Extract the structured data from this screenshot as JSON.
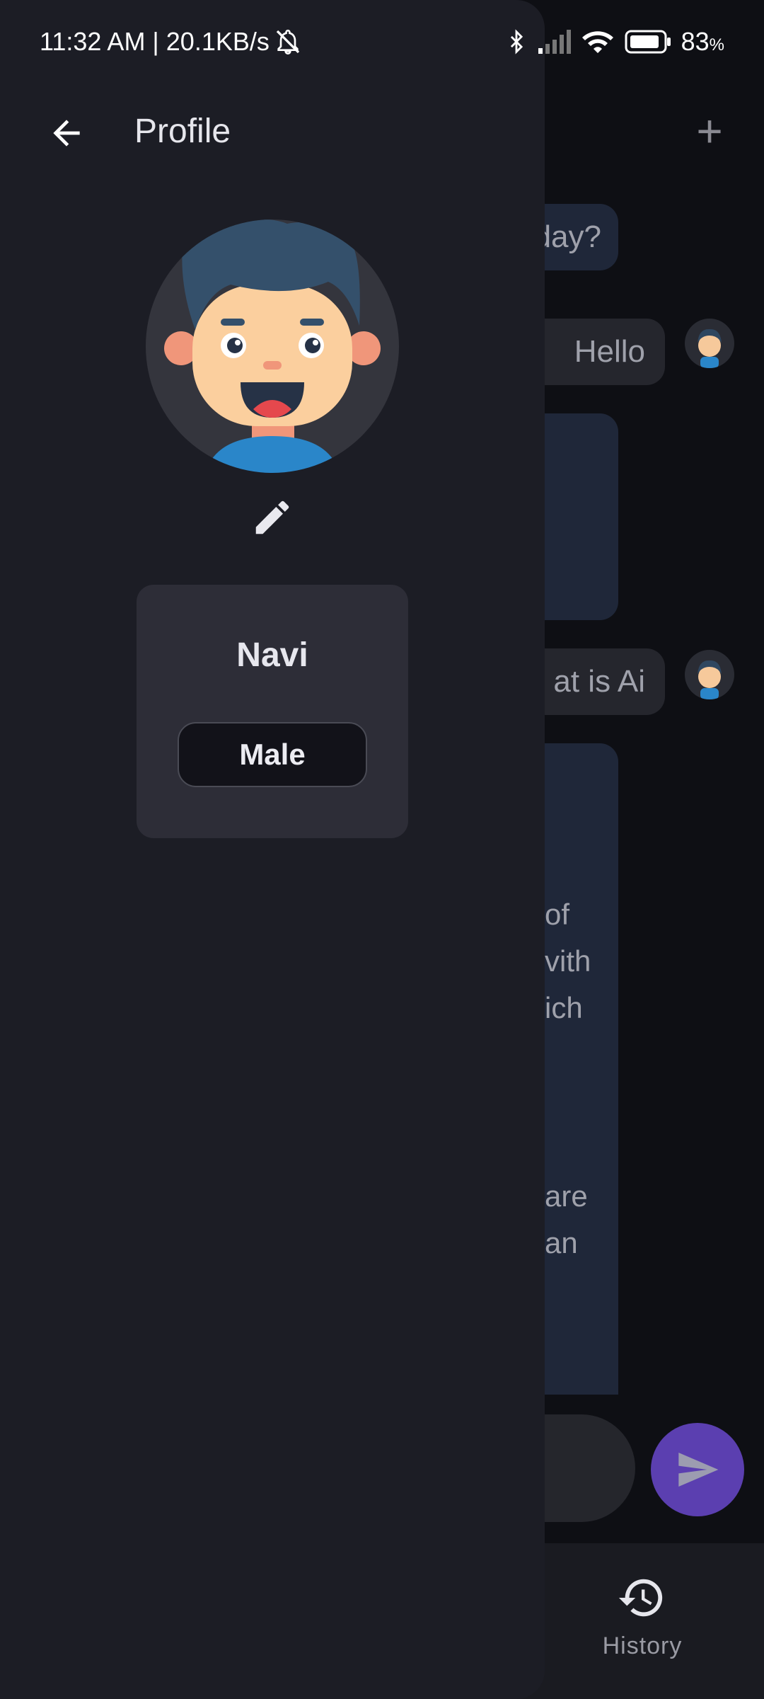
{
  "status_bar": {
    "time": "11:32 AM | 20.1KB/s",
    "battery": "83",
    "battery_unit": "%",
    "icons": [
      "mute-icon",
      "bluetooth-icon",
      "signal-icon",
      "wifi-icon",
      "battery-icon"
    ]
  },
  "drawer": {
    "title": "Profile",
    "back_icon": "arrow-left-icon",
    "edit_icon": "pencil-icon",
    "profile": {
      "name": "Navi",
      "gender": "Male"
    }
  },
  "background_chat": {
    "add_icon": "plus-icon",
    "visible_fragments": {
      "bubble1": "day?",
      "bubble2": "Hello",
      "bubble4": "at is Ai",
      "frag1": "of",
      "frag2": "vith",
      "frag3": "ich",
      "frag4": "are",
      "frag5": "an"
    },
    "send_icon": "send-icon",
    "nav": {
      "history_label": "History",
      "history_icon": "history-icon"
    }
  },
  "colors": {
    "drawer_bg": "#1c1d25",
    "card_bg": "#2d2d37",
    "send_button": "#5b3fb0",
    "ai_bubble": "#1f2739"
  }
}
